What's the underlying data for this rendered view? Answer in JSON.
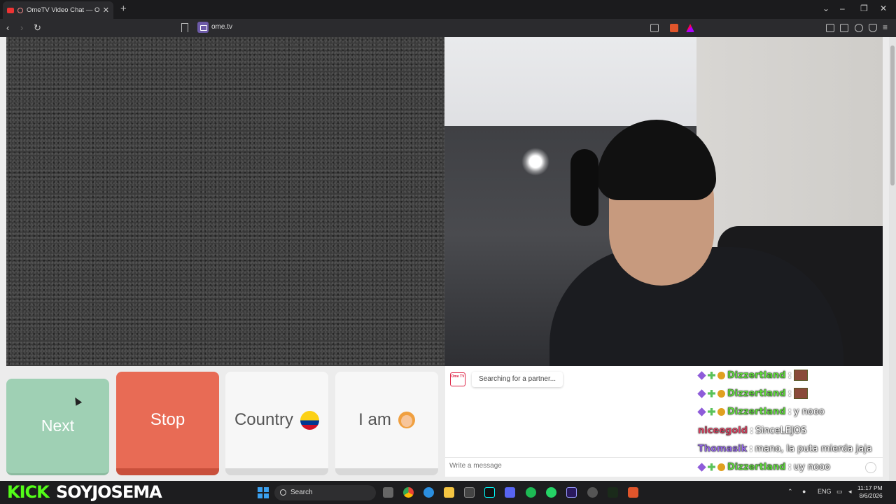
{
  "browser": {
    "tab_title": "OmeTV Video Chat — Omeg",
    "url": "ome.tv"
  },
  "overlay_chat": [
    {
      "user": "Dizzertland",
      "separator": ":",
      "message": "",
      "badges": [
        "purple",
        "green",
        "gold"
      ],
      "color": "#5fe03a",
      "emote": true
    },
    {
      "user": "Dizzertland",
      "separator": ":",
      "message": "",
      "badges": [
        "purple",
        "green",
        "gold"
      ],
      "color": "#5fe03a",
      "emote": true
    },
    {
      "user": "Dizzertland",
      "separator": ":",
      "message": "y nooo",
      "badges": [
        "purple",
        "green",
        "gold"
      ],
      "color": "#5fe03a",
      "emote": false
    },
    {
      "user": "niceegold",
      "separator": ":",
      "message": "SinceLEJOS",
      "badges": [],
      "color": "#e04060",
      "emote": false
    },
    {
      "user": "Thomasik",
      "separator": ":",
      "message": "mano, la puta mierda jaja",
      "badges": [],
      "color": "#9a6cf0",
      "emote": false
    },
    {
      "user": "Dizzertland",
      "separator": ":",
      "message": "uy nooo",
      "badges": [
        "purple",
        "green",
        "gold"
      ],
      "color": "#5fe03a",
      "emote": false
    }
  ],
  "controls": {
    "next_label": "Next",
    "stop_label": "Stop",
    "country_label": "Country",
    "iam_label": "I am"
  },
  "chat": {
    "logo_text": "Ome TV",
    "status": "Searching for a partner...",
    "input_placeholder": "Write a message"
  },
  "stream_overlay": {
    "platform": "KICK",
    "handle": "SOYJOSEMA"
  },
  "taskbar": {
    "search_label": "Search",
    "language": "ENG",
    "time": "11:17 PM",
    "date": "8/6/2026"
  },
  "colors": {
    "next": "#9fd0b4",
    "stop": "#e86b55",
    "kick_green": "#53fc18"
  }
}
